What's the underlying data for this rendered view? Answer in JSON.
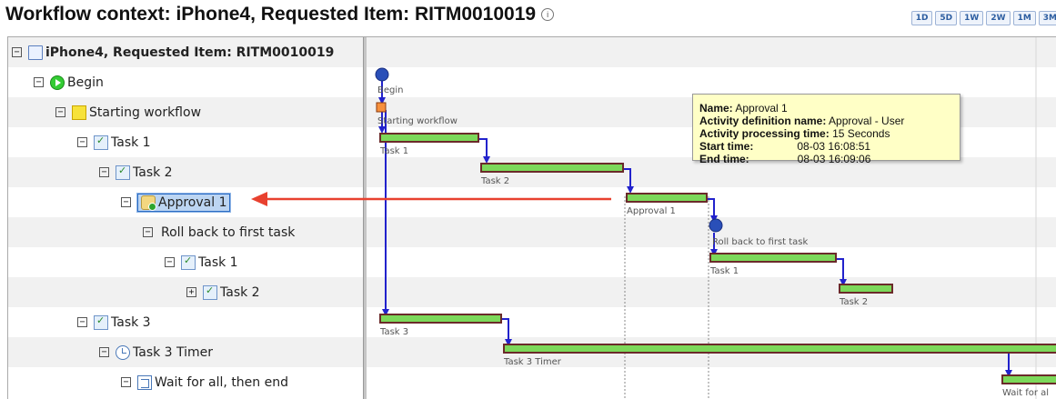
{
  "header": {
    "title": "Workflow context: iPhone4, Requested Item: RITM0010019",
    "info_icon": "i",
    "zoom_buttons": [
      "1D",
      "5D",
      "1W",
      "2W",
      "1M",
      "3M"
    ]
  },
  "tree": {
    "rows": [
      {
        "label": "iPhone4, Requested Item: RITM0010019",
        "toggle": "−",
        "icon": "document-icon"
      },
      {
        "label": "Begin",
        "toggle": "−",
        "icon": "begin-icon"
      },
      {
        "label": "Starting workflow",
        "toggle": "−",
        "icon": "note-icon"
      },
      {
        "label": "Task 1",
        "toggle": "−",
        "icon": "task-icon"
      },
      {
        "label": "Task 2",
        "toggle": "−",
        "icon": "task-icon"
      },
      {
        "label": "Approval 1",
        "toggle": "−",
        "icon": "approval-icon"
      },
      {
        "label": "Roll back to first task",
        "toggle": "−",
        "icon": ""
      },
      {
        "label": "Task 1",
        "toggle": "−",
        "icon": "task-icon"
      },
      {
        "label": "Task 2",
        "toggle": "+",
        "icon": "task-icon"
      },
      {
        "label": "Task 3",
        "toggle": "−",
        "icon": "task-icon"
      },
      {
        "label": "Task 3 Timer",
        "toggle": "−",
        "icon": "timer-icon"
      },
      {
        "label": "Wait for all, then end",
        "toggle": "−",
        "icon": "join-icon"
      }
    ]
  },
  "gantt": {
    "labels": [
      "Begin",
      "Starting workflow",
      "Task 1",
      "Task 2",
      "Approval 1",
      "Roll back to first task",
      "Task 1",
      "Task 2",
      "Task 3",
      "Task 3 Timer",
      "Wait for al"
    ]
  },
  "tooltip": {
    "name_label": "Name:",
    "name_value": "Approval 1",
    "def_label": "Activity definition name:",
    "def_value": "Approval - User",
    "proc_label": "Activity processing time:",
    "proc_value": "15 Seconds",
    "start_label": "Start time:",
    "start_value": "08-03 16:08:51",
    "end_label": "End time:",
    "end_value": "08-03 16:09:06"
  },
  "colors": {
    "bar_fill": "#7cd85a",
    "bar_border": "#6b2a2a",
    "link": "#2222cc",
    "arrow": "#e8412f",
    "milestone": "#2a4fb8"
  }
}
